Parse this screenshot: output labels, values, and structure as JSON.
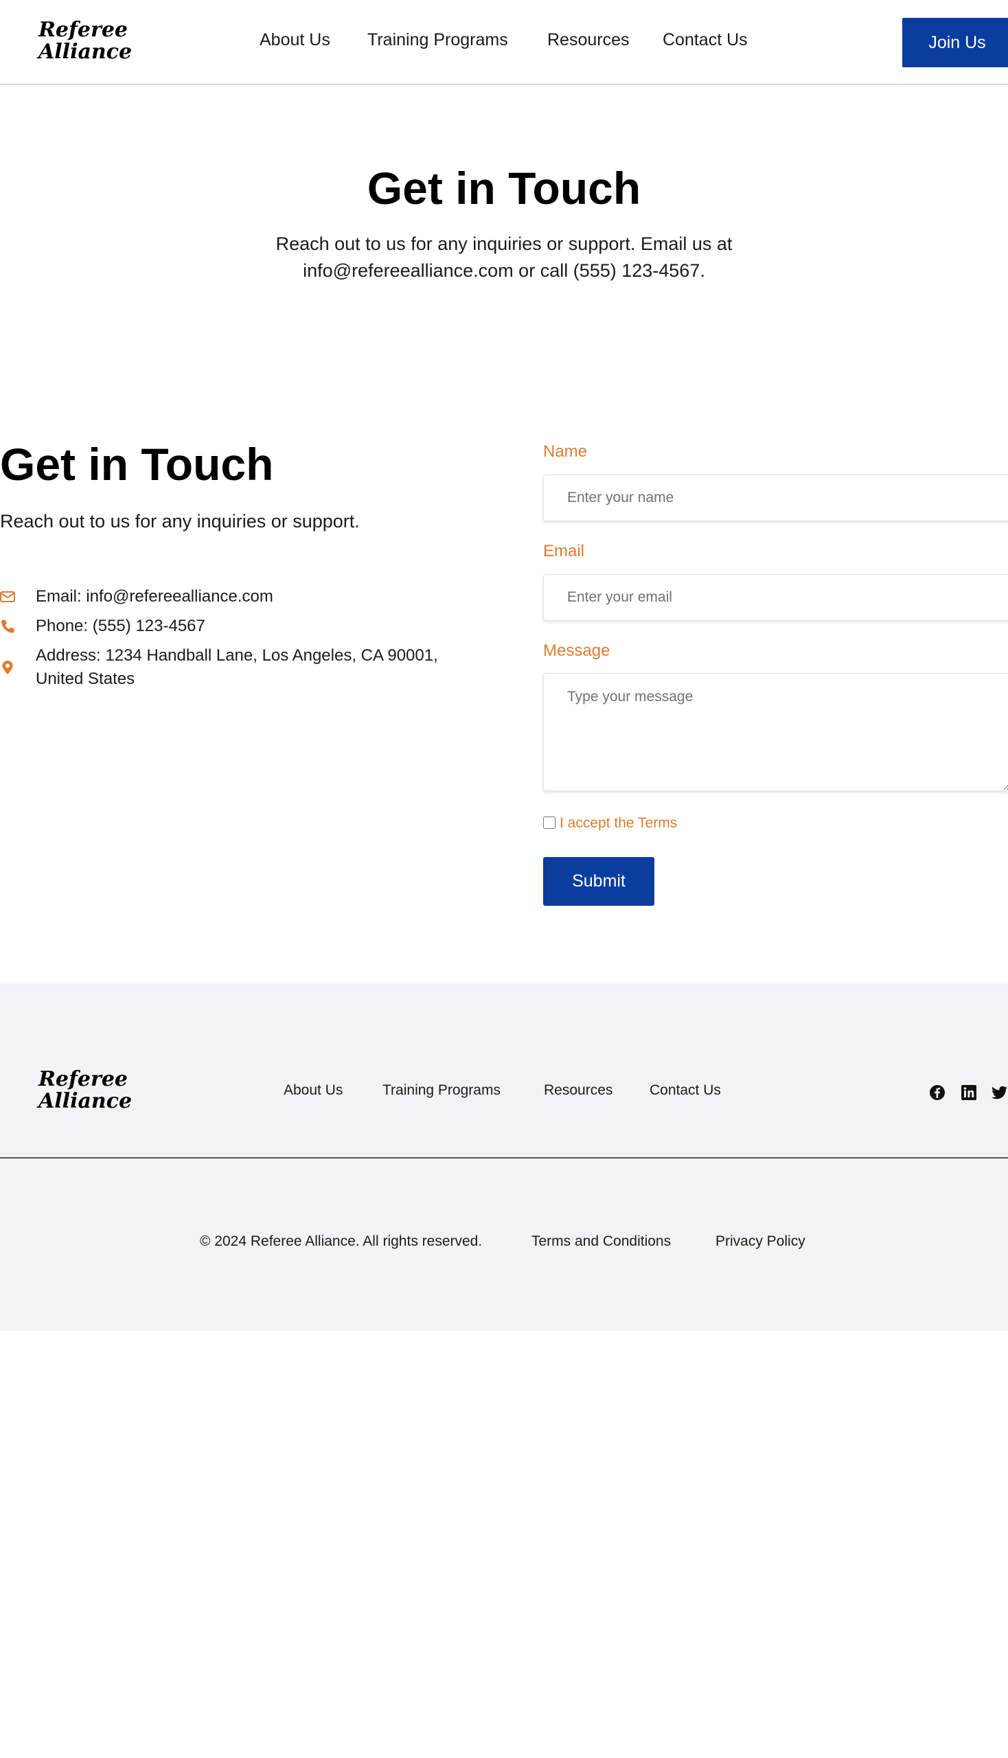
{
  "brand": {
    "line1": "Referee",
    "line2": "Alliance"
  },
  "nav": {
    "items": [
      "About Us",
      "Training Programs",
      "Resources",
      "Contact Us"
    ],
    "cta": "Join Us"
  },
  "hero": {
    "title": "Get in Touch",
    "text": "Reach out to us for any inquiries or support. Email us at info@refereealliance.com or call (555) 123-4567."
  },
  "contact": {
    "title": "Get in Touch",
    "subtitle": "Reach out to us for any inquiries or support.",
    "items": [
      {
        "icon": "mail-icon",
        "text": "Email: info@refereealliance.com"
      },
      {
        "icon": "phone-icon",
        "text": "Phone: (555) 123-4567"
      },
      {
        "icon": "location-pin-icon",
        "text": "Address: 1234 Handball Lane, Los Angeles, CA 90001, United States"
      }
    ]
  },
  "form": {
    "name_label": "Name",
    "name_placeholder": "Enter your name",
    "email_label": "Email",
    "email_placeholder": "Enter your email",
    "message_label": "Message",
    "message_placeholder": "Type your message",
    "terms_label": "I accept the Terms",
    "submit_label": "Submit"
  },
  "footer": {
    "nav": [
      "About Us",
      "Training Programs",
      "Resources",
      "Contact Us"
    ],
    "social": [
      "facebook-icon",
      "linkedin-icon",
      "twitter-icon"
    ],
    "copyright": "© 2024 Referee Alliance. All rights reserved.",
    "terms": "Terms and Conditions",
    "privacy": "Privacy Policy"
  },
  "colors": {
    "primary": "#0a3d9e",
    "accent": "#e07b2f",
    "footer_bg": "#f2f3f5"
  }
}
